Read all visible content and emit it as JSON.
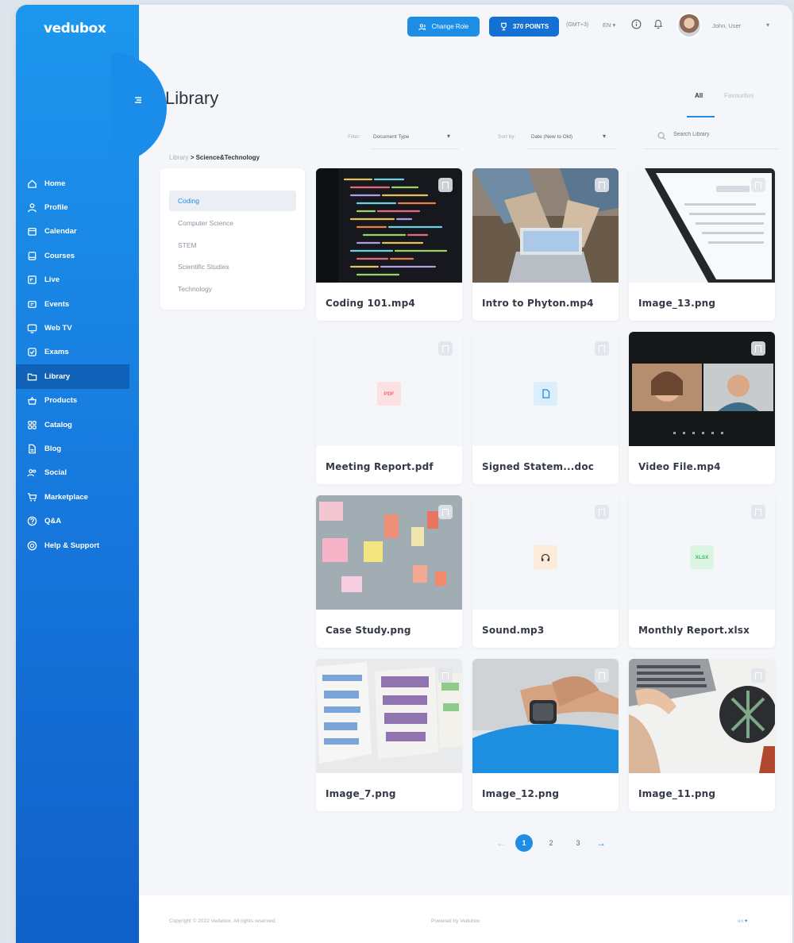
{
  "brand": {
    "logo": "vedubox"
  },
  "topbar": {
    "change_role": "Change Role",
    "points": "370 POINTS",
    "timezone": "(GMT+3)",
    "language": "EN",
    "user_name": "John, User"
  },
  "sidebar": {
    "items": [
      {
        "label": "Home",
        "icon": "home-icon"
      },
      {
        "label": "Profile",
        "icon": "user-icon"
      },
      {
        "label": "Calendar",
        "icon": "calendar-icon"
      },
      {
        "label": "Courses",
        "icon": "book-icon"
      },
      {
        "label": "Live",
        "icon": "live-icon"
      },
      {
        "label": "Events",
        "icon": "ticket-icon"
      },
      {
        "label": "Web TV",
        "icon": "tv-icon"
      },
      {
        "label": "Exams",
        "icon": "checklist-icon"
      },
      {
        "label": "Library",
        "icon": "folder-icon",
        "active": true
      },
      {
        "label": "Products",
        "icon": "basket-icon"
      },
      {
        "label": "Catalog",
        "icon": "grid-icon"
      },
      {
        "label": "Blog",
        "icon": "document-icon"
      },
      {
        "label": "Social",
        "icon": "users-icon"
      },
      {
        "label": "Marketplace",
        "icon": "cart-icon"
      },
      {
        "label": "Q&A",
        "icon": "question-icon"
      },
      {
        "label": "Help & Support",
        "icon": "lifebuoy-icon"
      }
    ]
  },
  "header": {
    "title": "Library",
    "tabs": [
      {
        "label": "All",
        "active": true
      },
      {
        "label": "Favourites"
      }
    ]
  },
  "filters": {
    "filter_label": "Filter:",
    "filter_value": "Document Type",
    "sort_label": "Sort by:",
    "sort_value": "Date (New to Old)",
    "search_placeholder": "Search Library"
  },
  "breadcrumb": {
    "root": "Library",
    "separator": ">",
    "current": "Science&Technology"
  },
  "categories": [
    {
      "label": "Coding",
      "active": true
    },
    {
      "label": "Computer Science"
    },
    {
      "label": "STEM"
    },
    {
      "label": "Scientific Studies"
    },
    {
      "label": "Technology"
    }
  ],
  "files": [
    {
      "name": "Coding 101.mp4",
      "kind": "image",
      "thumb": "code"
    },
    {
      "name": "Intro to Phyton.mp4",
      "kind": "image",
      "thumb": "laptop-hands"
    },
    {
      "name": "Image_13.png",
      "kind": "image",
      "thumb": "tablet"
    },
    {
      "name": "Meeting Report.pdf",
      "kind": "badge",
      "badge": "PDF",
      "badge_color": "#fde0e2",
      "badge_text_color": "#ef6d7b"
    },
    {
      "name": "Signed Statem...doc",
      "kind": "badge",
      "badge": "doc-icon",
      "badge_color": "#dbeefb",
      "badge_text_color": "#1d8de6"
    },
    {
      "name": "Video File.mp4",
      "kind": "image",
      "thumb": "video-call"
    },
    {
      "name": "Case Study.png",
      "kind": "image",
      "thumb": "sticky-notes"
    },
    {
      "name": "Sound.mp3",
      "kind": "badge",
      "badge": "headphones-icon",
      "badge_color": "#fdebd9",
      "badge_text_color": "#3a3a3a"
    },
    {
      "name": "Monthly Report.xlsx",
      "kind": "badge",
      "badge": "XLSX",
      "badge_color": "#dcf5e2",
      "badge_text_color": "#3cb862"
    },
    {
      "name": "Image_7.png",
      "kind": "image",
      "thumb": "wireframes"
    },
    {
      "name": "Image_12.png",
      "kind": "image",
      "thumb": "smartwatch"
    },
    {
      "name": "Image_11.png",
      "kind": "image",
      "thumb": "keyboard-desk"
    }
  ],
  "pagination": {
    "pages": [
      "1",
      "2",
      "3"
    ],
    "current": "1"
  },
  "footer": {
    "copyright": "Copyright © 2022 Vedubox. All rights reserved.",
    "powered": "Powered by Vedubox",
    "language": "en"
  },
  "colors": {
    "accent": "#1d8de6",
    "sidebar": "#1677dc",
    "background": "#f4f6f9"
  }
}
